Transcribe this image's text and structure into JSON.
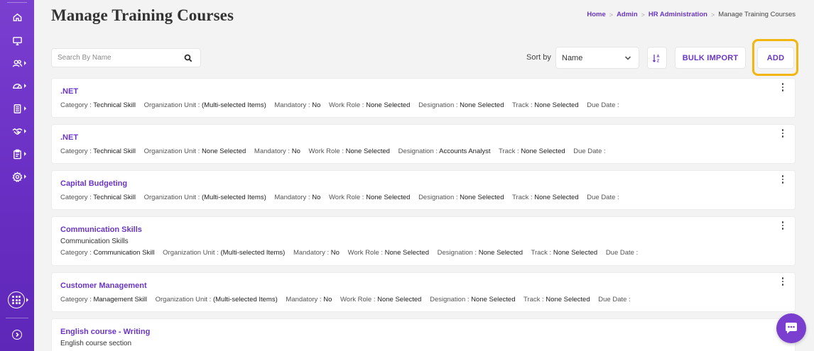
{
  "header": {
    "title": "Manage Training Courses",
    "breadcrumb": [
      {
        "label": "Home",
        "link": true
      },
      {
        "label": "Admin",
        "link": true
      },
      {
        "label": "HR Administration",
        "link": true
      },
      {
        "label": "Manage Training Courses",
        "link": false
      }
    ]
  },
  "toolbar": {
    "search_placeholder": "Search By Name",
    "sort_label": "Sort by",
    "sort_value": "Name",
    "bulk_import_label": "BULK IMPORT",
    "add_label": "ADD"
  },
  "field_labels": {
    "category": "Category :",
    "org_unit": "Organization Unit :",
    "mandatory": "Mandatory :",
    "work_role": "Work Role :",
    "designation": "Designation :",
    "track": "Track :",
    "due_date": "Due Date :"
  },
  "courses": [
    {
      "title": ".NET",
      "description": "",
      "category": "Technical Skill",
      "org_unit": "(Multi-selected Items)",
      "mandatory": "No",
      "work_role": "None Selected",
      "designation": "None Selected",
      "track": "None Selected",
      "due_date": ""
    },
    {
      "title": ".NET",
      "description": "",
      "category": "Technical Skill",
      "org_unit": "None Selected",
      "mandatory": "No",
      "work_role": "None Selected",
      "designation": "Accounts Analyst",
      "track": "None Selected",
      "due_date": ""
    },
    {
      "title": "Capital Budgeting",
      "description": "",
      "category": "Technical Skill",
      "org_unit": "(Multi-selected Items)",
      "mandatory": "No",
      "work_role": "None Selected",
      "designation": "None Selected",
      "track": "None Selected",
      "due_date": ""
    },
    {
      "title": "Communication Skills",
      "description": "Communication Skills",
      "category": "Communication Skill",
      "org_unit": "(Multi-selected Items)",
      "mandatory": "No",
      "work_role": "None Selected",
      "designation": "None Selected",
      "track": "None Selected",
      "due_date": ""
    },
    {
      "title": "Customer Management",
      "description": "",
      "category": "Management Skill",
      "org_unit": "(Multi-selected Items)",
      "mandatory": "No",
      "work_role": "None Selected",
      "designation": "None Selected",
      "track": "None Selected",
      "due_date": ""
    },
    {
      "title": "English course - Writing",
      "description": "English course section",
      "category": "",
      "org_unit": "",
      "mandatory": "",
      "work_role": "",
      "designation": "",
      "track": "",
      "due_date": ""
    }
  ],
  "sidebar": {
    "items": [
      {
        "icon": "home-icon"
      },
      {
        "icon": "monitor-icon"
      },
      {
        "icon": "users-icon"
      },
      {
        "icon": "dashboard-gauge-icon"
      },
      {
        "icon": "document-stack-icon"
      },
      {
        "icon": "handshake-icon"
      },
      {
        "icon": "clipboard-icon"
      },
      {
        "icon": "settings-gear-icon"
      }
    ],
    "apps_icon": "apps-grid-icon",
    "collapse_icon": "chevron-right-icon"
  },
  "colors": {
    "sidebar": "#6a2fc4",
    "accent": "#6a36c4",
    "highlight": "#f3b50f",
    "background": "#f3f3f3"
  }
}
